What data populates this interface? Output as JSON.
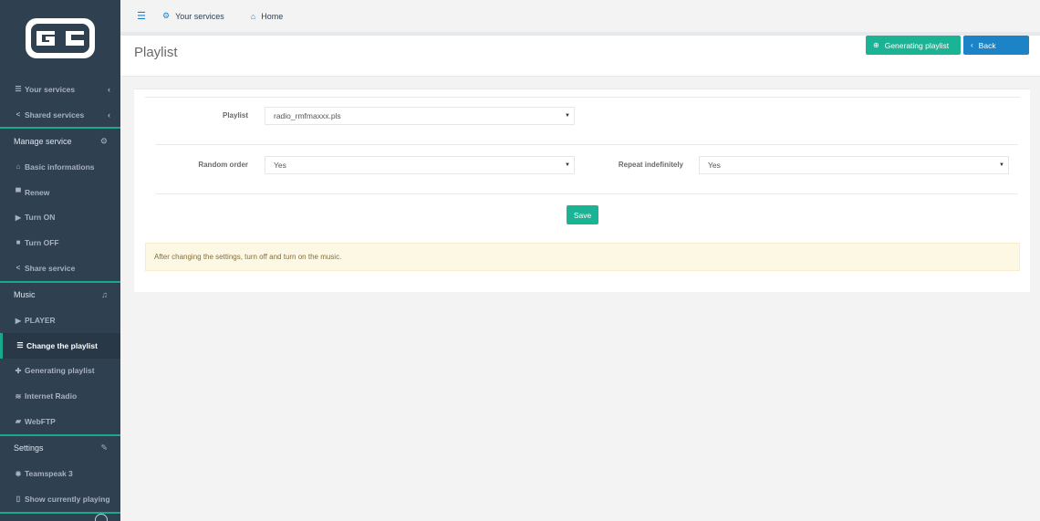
{
  "sidebar": {
    "logo_icon": "brand-logo",
    "items": [
      {
        "label": "Your services",
        "icon": "list-icon",
        "caret": "‹"
      },
      {
        "label": "Shared services",
        "icon": "share-icon",
        "caret": "‹"
      },
      {
        "label": "Manage service",
        "icon": "cogs-icon"
      },
      {
        "label": "Basic informations",
        "icon": "home-icon"
      },
      {
        "label": "Renew",
        "icon": "cart-icon"
      },
      {
        "label": "Turn ON",
        "icon": "play-icon"
      },
      {
        "label": "Turn OFF",
        "icon": "stop-icon"
      },
      {
        "label": "Share service",
        "icon": "share-icon"
      },
      {
        "label": "Music",
        "icon": "music-icon"
      },
      {
        "label": "PLAYER",
        "icon": "play-icon"
      },
      {
        "label": "Change the playlist",
        "icon": "bars-icon"
      },
      {
        "label": "Generating playlist",
        "icon": "plus-circle-icon"
      },
      {
        "label": "Internet Radio",
        "icon": "rss-icon"
      },
      {
        "label": "WebFTP",
        "icon": "folder-icon"
      },
      {
        "label": "Settings",
        "icon": "wrench-icon"
      },
      {
        "label": "Teamspeak 3",
        "icon": "gear-icon"
      },
      {
        "label": "Show currently playing",
        "icon": "file-icon"
      }
    ]
  },
  "topbar": {
    "crumbs": [
      {
        "label": "Your services",
        "icon": "cogs-icon"
      },
      {
        "label": "Home",
        "icon": "home-icon"
      }
    ]
  },
  "heading": {
    "title": "Playlist",
    "generate_label": "Generating playlist",
    "back_label": "Back"
  },
  "form": {
    "playlist_label": "Playlist",
    "playlist_value": "radio_rmfmaxxx.pls",
    "random_label": "Random order",
    "random_value": "Yes",
    "repeat_label": "Repeat indefinitely",
    "repeat_value": "Yes",
    "save_label": "Save"
  },
  "alert": {
    "text": "After changing the settings, turn off and turn on the music."
  },
  "colors": {
    "sidebar_bg": "#2f4050",
    "accent": "#1ab394",
    "primary": "#1c84c6",
    "alert_bg": "#fcf8e3"
  }
}
